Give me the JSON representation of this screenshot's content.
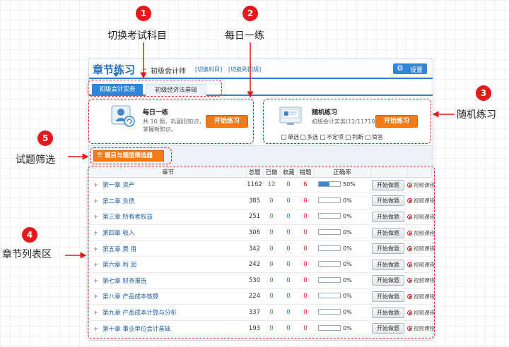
{
  "annotations": [
    {
      "num": "1",
      "label": "切换考试科目"
    },
    {
      "num": "2",
      "label": "每日一练"
    },
    {
      "num": "3",
      "label": "随机练习"
    },
    {
      "num": "4",
      "label": "章节列表区"
    },
    {
      "num": "5",
      "label": "试题筛选"
    }
  ],
  "header": {
    "title": "章节练习",
    "separator": "-",
    "subject": "初级会计师",
    "switch_subject": "[切换科目]",
    "switch_old": "[切换到旧版]",
    "settings_label": "设置"
  },
  "tabs": [
    {
      "label": "初级会计实务",
      "active": true
    },
    {
      "label": "初级经济法基础",
      "active": false
    }
  ],
  "daily": {
    "title": "每日一练",
    "desc_line1": "共 10 题，巩固旧知识，",
    "desc_line2": "掌握新知识。",
    "button": "开始练习"
  },
  "random": {
    "title": "随机练习",
    "desc": "初级会计实务(12/11718)",
    "button": "开始练习",
    "types": [
      "单选",
      "多选",
      "不定项",
      "判断",
      "简答"
    ]
  },
  "filter_button": "题目与题型筛选器",
  "columns": {
    "chapter": "章节",
    "total": "总题",
    "done": "已做",
    "fav": "收藏",
    "wrong": "错题",
    "rate": "正确率"
  },
  "row_action": "开始做题",
  "row_video": "视频课程",
  "chapters": [
    {
      "name": "第一章 资产",
      "total": "1162",
      "done": "12",
      "fav": "0",
      "wrong": "6",
      "rate": "50%",
      "rate_value": 0.5
    },
    {
      "name": "第二章   负债",
      "total": "385",
      "done": "0",
      "fav": "0",
      "wrong": "0",
      "rate": "0%",
      "rate_value": 0
    },
    {
      "name": "第三章   所有者权益",
      "total": "251",
      "done": "0",
      "fav": "0",
      "wrong": "0",
      "rate": "0%",
      "rate_value": 0
    },
    {
      "name": "第四章   收入",
      "total": "306",
      "done": "0",
      "fav": "0",
      "wrong": "0",
      "rate": "0%",
      "rate_value": 0
    },
    {
      "name": "第五章   费 用",
      "total": "342",
      "done": "0",
      "fav": "0",
      "wrong": "0",
      "rate": "0%",
      "rate_value": 0
    },
    {
      "name": "第六章   利 润",
      "total": "242",
      "done": "0",
      "fav": "0",
      "wrong": "0",
      "rate": "0%",
      "rate_value": 0
    },
    {
      "name": "第七章   财务报告",
      "total": "530",
      "done": "0",
      "fav": "0",
      "wrong": "0",
      "rate": "0%",
      "rate_value": 0
    },
    {
      "name": "第八章   产品成本核算",
      "total": "224",
      "done": "0",
      "fav": "0",
      "wrong": "0",
      "rate": "0%",
      "rate_value": 0
    },
    {
      "name": "第九章   产品成本计算与分析",
      "total": "337",
      "done": "0",
      "fav": "0",
      "wrong": "0",
      "rate": "0%",
      "rate_value": 0
    },
    {
      "name": "第十章   事业单位会计基础",
      "total": "193",
      "done": "0",
      "fav": "0",
      "wrong": "0",
      "rate": "0%",
      "rate_value": 0
    }
  ],
  "colors": {
    "accent": "#2f86d8",
    "orange": "#f07b1a",
    "annotation": "#e4191b"
  }
}
